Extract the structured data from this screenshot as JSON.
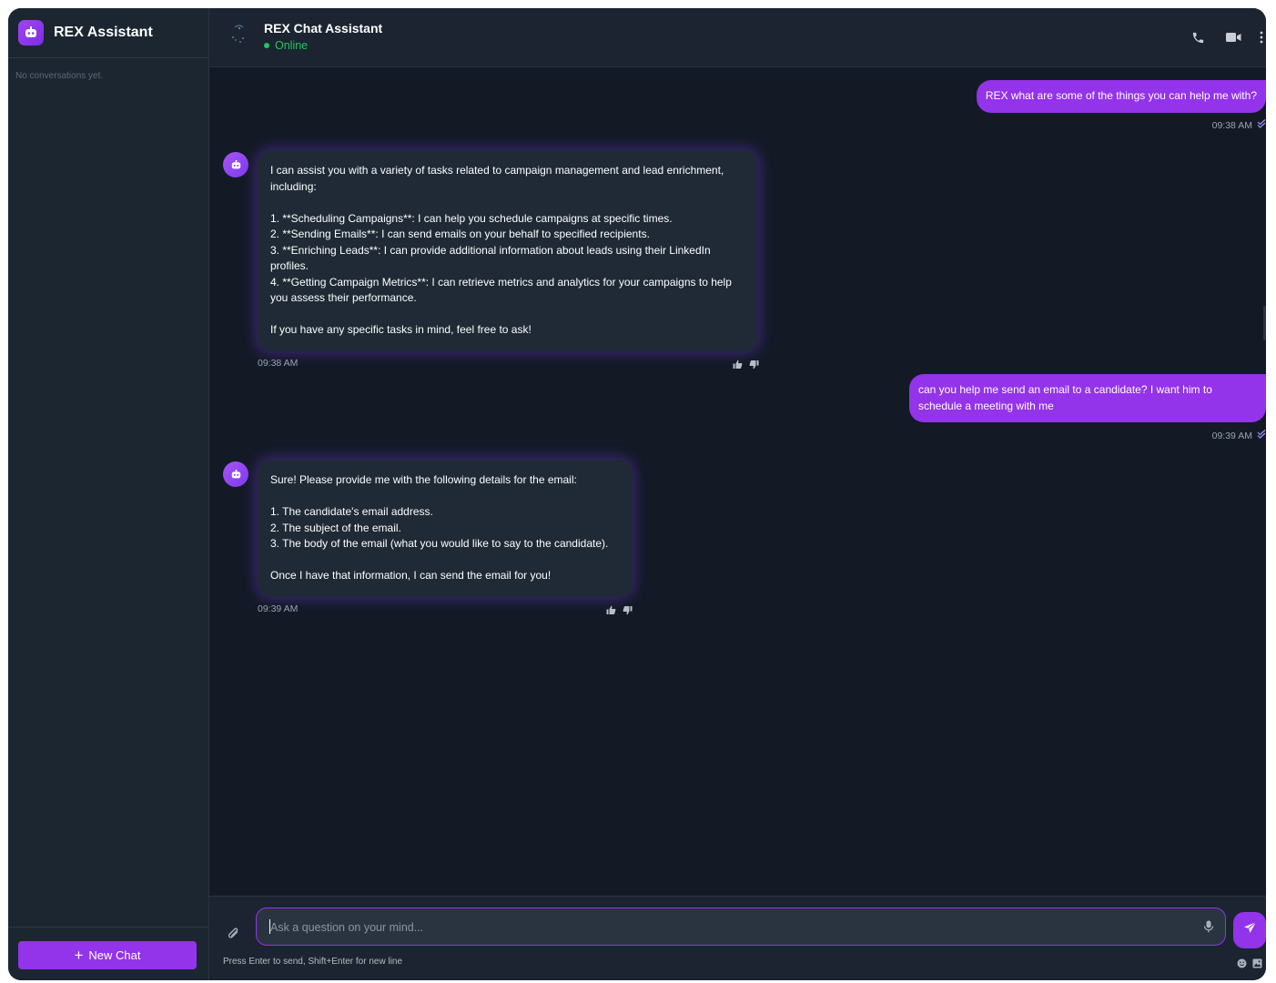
{
  "sidebar": {
    "title": "REX Assistant",
    "empty_text": "No conversations yet.",
    "new_chat_label": "New Chat"
  },
  "header": {
    "title": "REX Chat Assistant",
    "status": "Online"
  },
  "messages": [
    {
      "role": "user",
      "text": "REX what are some of the things you can help me with?",
      "time": "09:38 AM"
    },
    {
      "role": "assistant",
      "text": "I can assist you with a variety of tasks related to campaign management and lead enrichment, including:\n\n1. **Scheduling Campaigns**: I can help you schedule campaigns at specific times.\n2. **Sending Emails**: I can send emails on your behalf to specified recipients.\n3. **Enriching Leads**: I can provide additional information about leads using their LinkedIn profiles.\n4. **Getting Campaign Metrics**: I can retrieve metrics and analytics for your campaigns to help you assess their performance.\n\nIf you have any specific tasks in mind, feel free to ask!",
      "time": "09:38 AM"
    },
    {
      "role": "user",
      "text": "can you help me send an email to a candidate? I want him to schedule a meeting with me",
      "time": "09:39 AM"
    },
    {
      "role": "assistant",
      "text": "Sure! Please provide me with the following details for the email:\n\n1. The candidate's email address.\n2. The subject of the email.\n3. The body of the email (what you would like to say to the candidate).\n\nOnce I have that information, I can send the email for you!",
      "time": "09:39 AM"
    }
  ],
  "composer": {
    "placeholder": "Ask a question on your mind...",
    "hint": "Press Enter to send, Shift+Enter for new line"
  },
  "colors": {
    "accent": "#9333ea",
    "online": "#22c55e",
    "background": "#131a26",
    "panel": "#1c2631",
    "bot_bubble": "#1f2a36"
  },
  "icons": [
    "robot-icon",
    "phone-icon",
    "video-icon",
    "more-vertical-icon",
    "double-check-icon",
    "thumbs-up-icon",
    "thumbs-down-icon",
    "paperclip-icon",
    "mic-icon",
    "send-icon",
    "emoji-icon",
    "image-icon",
    "plus-icon"
  ]
}
